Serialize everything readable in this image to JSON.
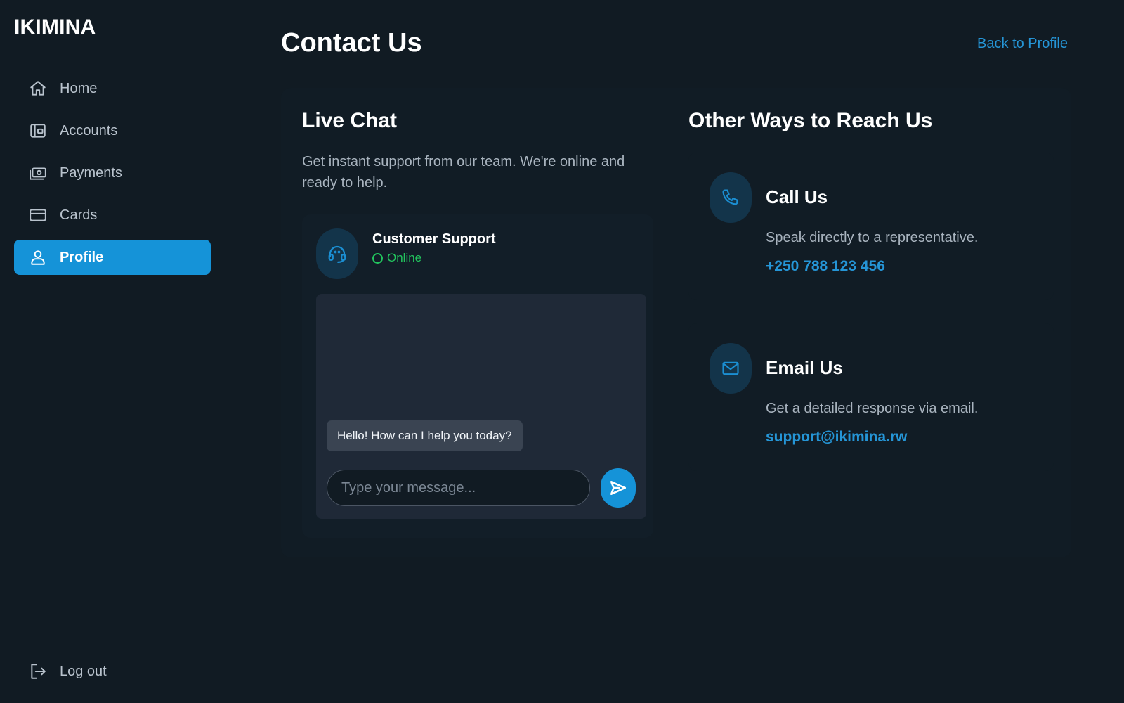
{
  "brand": "IKIMINA",
  "nav": {
    "items": [
      {
        "label": "Home",
        "icon": "home-icon"
      },
      {
        "label": "Accounts",
        "icon": "wallet-icon"
      },
      {
        "label": "Payments",
        "icon": "cash-icon"
      },
      {
        "label": "Cards",
        "icon": "credit-card-icon"
      },
      {
        "label": "Profile",
        "icon": "user-icon",
        "active": true
      }
    ],
    "logout": {
      "label": "Log out",
      "icon": "logout-icon"
    }
  },
  "header": {
    "title": "Contact Us",
    "back_link": "Back to Profile"
  },
  "live_chat": {
    "title": "Live Chat",
    "description": "Get instant support from our team. We're online and ready to help.",
    "agent_name": "Customer Support",
    "agent_status": "Online",
    "messages": [
      {
        "from": "support",
        "text": "Hello! How can I help you today?"
      }
    ],
    "input_placeholder": "Type your message..."
  },
  "other_ways": {
    "title": "Other Ways to Reach Us",
    "call": {
      "title": "Call Us",
      "description": "Speak directly to a representative.",
      "value": "+250 788 123 456"
    },
    "email": {
      "title": "Email Us",
      "description": "Get a detailed response via email.",
      "value": "support@ikimina.rw"
    }
  },
  "colors": {
    "background": "#111b23",
    "accent": "#1593d8",
    "link": "#2595d6",
    "online": "#22c55e"
  }
}
